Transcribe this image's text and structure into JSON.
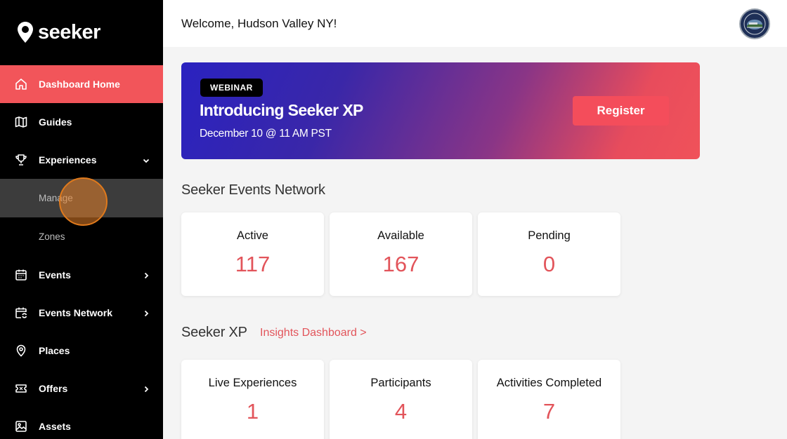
{
  "brand": {
    "name": "seeker",
    "accent": "#f2555a"
  },
  "sidebar": {
    "items": [
      {
        "label": "Dashboard Home",
        "icon": "home-icon",
        "active": true
      },
      {
        "label": "Guides",
        "icon": "map-icon"
      },
      {
        "label": "Experiences",
        "icon": "trophy-icon",
        "expanded": true,
        "children": [
          {
            "label": "Manage"
          },
          {
            "label": "Zones"
          }
        ]
      },
      {
        "label": "Events",
        "icon": "calendar-icon"
      },
      {
        "label": "Events Network",
        "icon": "calendar-sync-icon"
      },
      {
        "label": "Places",
        "icon": "pin-icon"
      },
      {
        "label": "Offers",
        "icon": "ticket-icon"
      },
      {
        "label": "Assets",
        "icon": "image-icon"
      }
    ]
  },
  "header": {
    "welcome": "Welcome, Hudson Valley NY!",
    "avatar_icon": "org-seal-icon"
  },
  "banner": {
    "badge": "WEBINAR",
    "title": "Introducing Seeker XP",
    "subtitle": "December 10  @  11 AM PST",
    "button": "Register"
  },
  "events_network": {
    "title": "Seeker Events Network",
    "cards": [
      {
        "label": "Active",
        "value": "117"
      },
      {
        "label": "Available",
        "value": "167"
      },
      {
        "label": "Pending",
        "value": "0"
      }
    ]
  },
  "seeker_xp": {
    "title": "Seeker XP",
    "link": "Insights Dashboard >",
    "cards": [
      {
        "label": "Live Experiences",
        "value": "1"
      },
      {
        "label": "Participants",
        "value": "4"
      },
      {
        "label": "Activities Completed",
        "value": "7"
      }
    ]
  }
}
